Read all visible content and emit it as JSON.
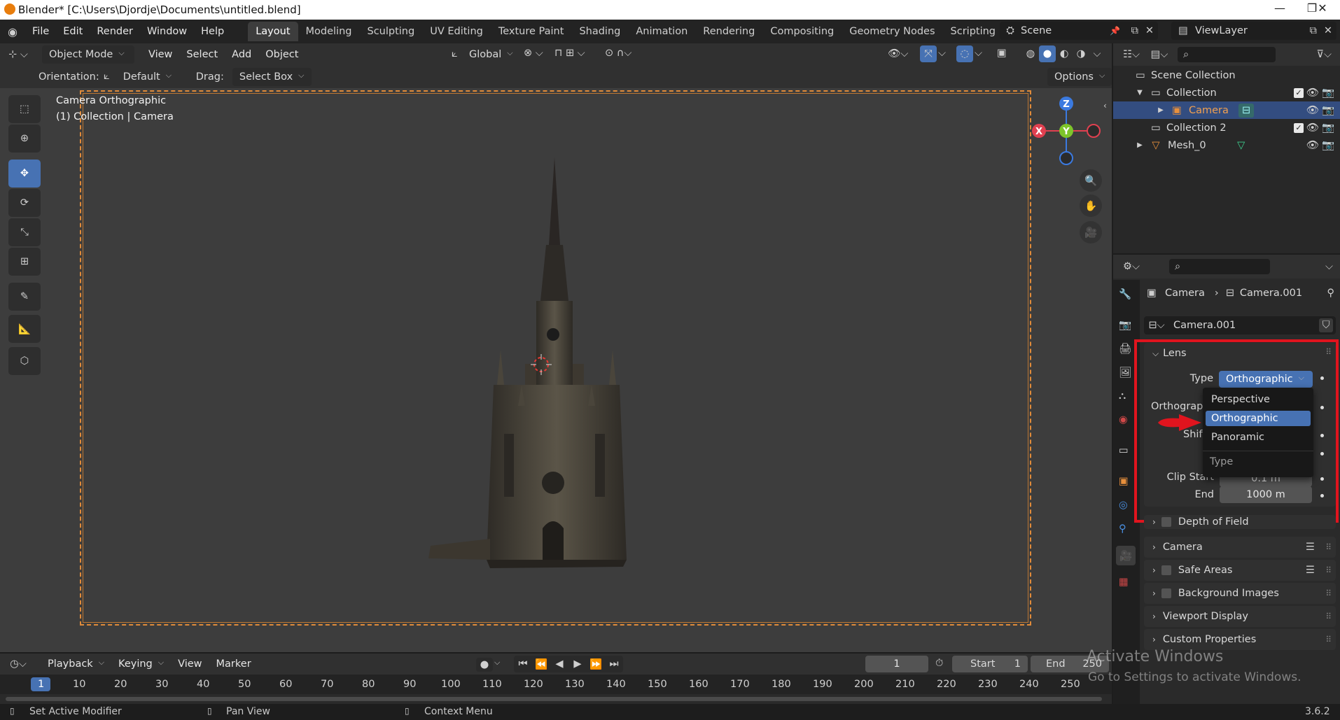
{
  "window": {
    "title": "Blender* [C:\\Users\\Djordje\\Documents\\untitled.blend]",
    "minimize": "—",
    "maximize": "❐",
    "close": "✕"
  },
  "menu": [
    "File",
    "Edit",
    "Render",
    "Window",
    "Help"
  ],
  "workspaces": [
    "Layout",
    "Modeling",
    "Sculpting",
    "UV Editing",
    "Texture Paint",
    "Shading",
    "Animation",
    "Rendering",
    "Compositing",
    "Geometry Nodes",
    "Scripting",
    "+"
  ],
  "scene": "Scene",
  "view_layer": "ViewLayer",
  "header": {
    "mode": "Object Mode",
    "view": "View",
    "select": "Select",
    "add": "Add",
    "object": "Object",
    "transform": "Global"
  },
  "tool_header": {
    "orientation_label": "Orientation:",
    "orientation_value": "Default",
    "drag_label": "Drag:",
    "drag_value": "Select Box",
    "options": "Options"
  },
  "viewport": {
    "view_name": "Camera Orthographic",
    "collection_info": "(1) Collection | Camera",
    "gizmo": {
      "z": "Z",
      "y": "Y",
      "x": "X"
    }
  },
  "outliner": {
    "rows": [
      {
        "label": "Scene Collection"
      },
      {
        "label": "Collection"
      },
      {
        "label": "Camera"
      },
      {
        "label": "Collection 2"
      },
      {
        "label": "Mesh_0"
      }
    ]
  },
  "properties": {
    "breadcrumb_object": "Camera",
    "breadcrumb_data": "Camera.001",
    "datablock": "Camera.001",
    "lens": {
      "title": "Lens",
      "type_label": "Type",
      "type_value": "Orthographic",
      "ortho_label": "Orthograph",
      "shift_label": "Shift",
      "clip_start_label": "Clip Start",
      "clip_start_value": "0.1 m",
      "end_label": "End",
      "end_value": "1000 m"
    },
    "dropdown": {
      "options": [
        "Perspective",
        "Orthographic",
        "Panoramic"
      ],
      "selected": "Orthographic",
      "footer": "Type"
    },
    "panels": [
      "Depth of Field",
      "Camera",
      "Safe Areas",
      "Background Images",
      "Viewport Display",
      "Custom Properties"
    ]
  },
  "timeline": {
    "playback": "Playback",
    "keying": "Keying",
    "view": "View",
    "marker": "Marker",
    "current_frame": "1",
    "start_label": "Start",
    "start_value": "1",
    "end_label": "End",
    "end_value": "250",
    "ruler": [
      "1",
      "10",
      "20",
      "30",
      "40",
      "50",
      "60",
      "70",
      "80",
      "90",
      "100",
      "110",
      "120",
      "130",
      "140",
      "150",
      "160",
      "170",
      "180",
      "190",
      "200",
      "210",
      "220",
      "230",
      "240",
      "250"
    ]
  },
  "status": {
    "left": "Set Active Modifier",
    "middle": "Pan View",
    "right": "Context Menu",
    "version": "3.6.2"
  },
  "watermark": {
    "line1": "Activate Windows",
    "line2": "Go to Settings to activate Windows."
  },
  "colors": {
    "accent": "#4772b3",
    "highlight_box": "#e0141e",
    "camera_frame": "#e08b3a"
  }
}
